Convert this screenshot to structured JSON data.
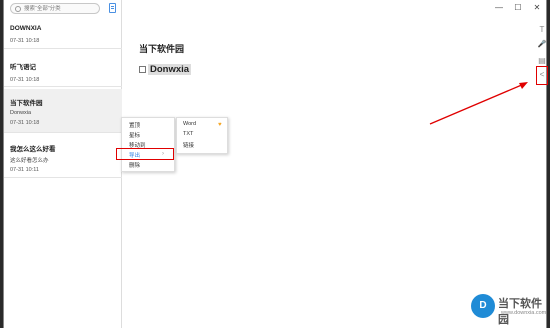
{
  "search": {
    "placeholder": "搜索“全部”分类"
  },
  "window_controls": {
    "minimize": "—",
    "maximize": "☐",
    "close": "✕"
  },
  "notes": [
    {
      "title": "DOWNXIA",
      "preview": "",
      "time": "07-31 10:18"
    },
    {
      "title": "听飞语记",
      "preview": "",
      "time": "07-31 10:18"
    },
    {
      "title": "当下软件园",
      "preview": "Donwxia",
      "time": "07-31 10:18"
    },
    {
      "title": "我怎么这么好看",
      "preview": "这么好看怎么办",
      "time": "07-31 10:11"
    }
  ],
  "editor": {
    "title": "当下软件园",
    "checkbox_text": "Donwxia"
  },
  "toolbar": {
    "text": "T",
    "mic": "🎤",
    "save": "▤",
    "share": "<"
  },
  "context_menu": {
    "items": [
      "置顶",
      "星标",
      "移动到",
      "导出",
      "删除"
    ]
  },
  "submenu": {
    "items": [
      "Word",
      "TXT",
      "链接"
    ],
    "vip_icon": "♥"
  },
  "watermark": {
    "logo_text": "D",
    "name": "当下软件园",
    "url": "www.downxia.com"
  }
}
